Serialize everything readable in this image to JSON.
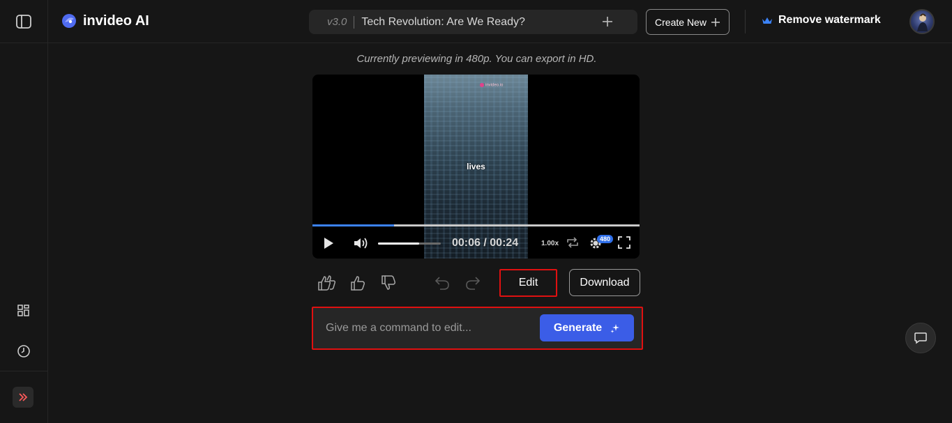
{
  "header": {
    "logo_text": "invideo AI",
    "version": "v3.0",
    "project_title": "Tech Revolution: Are We Ready?",
    "create_new_label": "Create New",
    "remove_watermark_label": "Remove watermark"
  },
  "sidebar": {
    "icons": [
      "sidebar-toggle-icon",
      "grid-icon",
      "clock-icon",
      "chevron-double-right-icon"
    ]
  },
  "preview": {
    "note": "Currently previewing in 480p. You can export in HD.",
    "video_watermark": "invideo.io",
    "caption": "lives",
    "progress_fraction": 0.25,
    "volume_fraction": 0.66,
    "current_time": "00:06",
    "duration": "00:24",
    "speed": "1.00x",
    "quality": "480"
  },
  "actions": {
    "edit_label": "Edit",
    "download_label": "Download"
  },
  "command": {
    "placeholder": "Give me a command to edit...",
    "generate_label": "Generate"
  },
  "colors": {
    "background": "#161616",
    "accent": "#3b5de7",
    "progress": "#3b82f6",
    "highlight_border": "#e01010"
  }
}
